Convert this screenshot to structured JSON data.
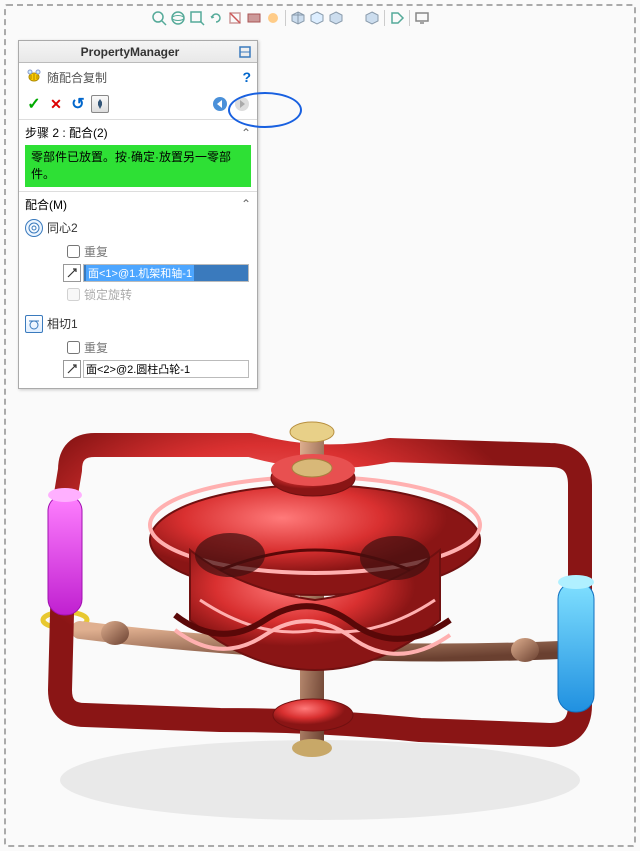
{
  "toolbar": {
    "icons": [
      "color-icon",
      "zoom-area",
      "rotate-view",
      "section-view",
      "display-style",
      "scene",
      "view-orientation",
      "hide-show",
      "box1",
      "box2",
      "box3",
      "box4",
      "box5",
      "screen"
    ]
  },
  "panel": {
    "title": "PropertyManager",
    "sub_icon": "bee-icon",
    "sub_title": "随配合复制",
    "help": "?",
    "actions": {
      "ok": "✓",
      "cancel": "✕",
      "undo": "↶",
      "pin": "📌",
      "back": "◀",
      "forward": "▶"
    },
    "step": {
      "label": "步骤 2 : 配合(2)",
      "message": "零部件已放置。按·确定·放置另一零部件。"
    },
    "mates": {
      "header": "配合(M)",
      "list": [
        {
          "type": "concentric",
          "label": "同心2",
          "repeat_label": "重复",
          "repeat_checked": false,
          "selection": "面<1>@1.机架和轴-1",
          "highlighted": true,
          "lock_label": "锁定旋转",
          "lock_disabled": true
        },
        {
          "type": "tangent",
          "label": "相切1",
          "repeat_label": "重复",
          "repeat_checked": false,
          "selection": "面<2>@2.圆柱凸轮-1",
          "highlighted": false
        }
      ]
    }
  }
}
